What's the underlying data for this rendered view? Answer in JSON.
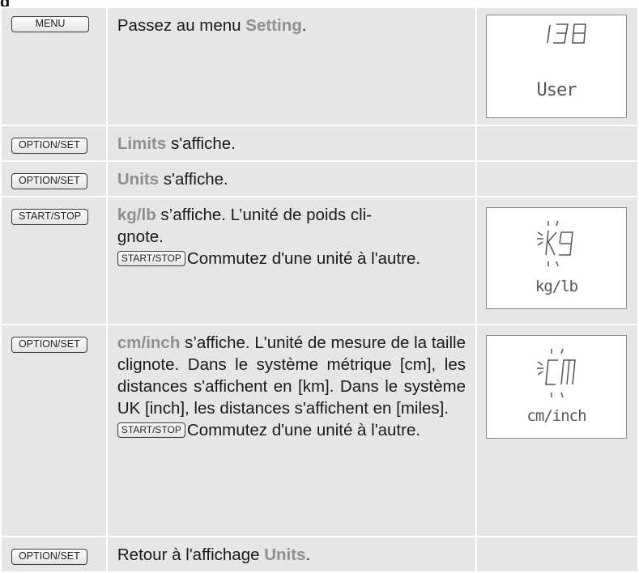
{
  "fragment": {
    "text": "g"
  },
  "rows": [
    {
      "key": "MENU",
      "text_parts": [
        "Passez au menu ",
        "Setting",
        "."
      ],
      "display": {
        "number": "138",
        "label": "User"
      }
    },
    {
      "key": "OPTION/SET",
      "text_parts": [
        "Limits",
        " s'affiche."
      ]
    },
    {
      "key": "OPTION/SET",
      "text_parts": [
        "Units",
        " s'affiche."
      ]
    },
    {
      "key": "START/STOP",
      "text_parts": [
        "kg/lb",
        " s’affiche. L’unité de poids cli-\ngnote."
      ],
      "inline_key": "START/STOP",
      "after_key": "Commutez d'une unité à l'autre.",
      "display": {
        "unit": "kg",
        "label": "kg/lb",
        "blink": true
      }
    },
    {
      "key": "OPTION/SET",
      "text_parts": [
        "cm/inch",
        " s’affiche. L'unité de mesure de la taille clignote. Dans le système métrique [cm], les distances s'affichent en [km]. Dans le système UK [inch], les distances s'affichent en [miles]."
      ],
      "inline_key": "START/STOP",
      "after_key": "Commutez d'une unité à l'autre.",
      "display": {
        "unit": "cm",
        "label": "cm/inch",
        "blink": true
      }
    },
    {
      "key": "OPTION/SET",
      "text_parts": [
        "Retour à l'affichage ",
        "Units",
        "."
      ]
    }
  ]
}
